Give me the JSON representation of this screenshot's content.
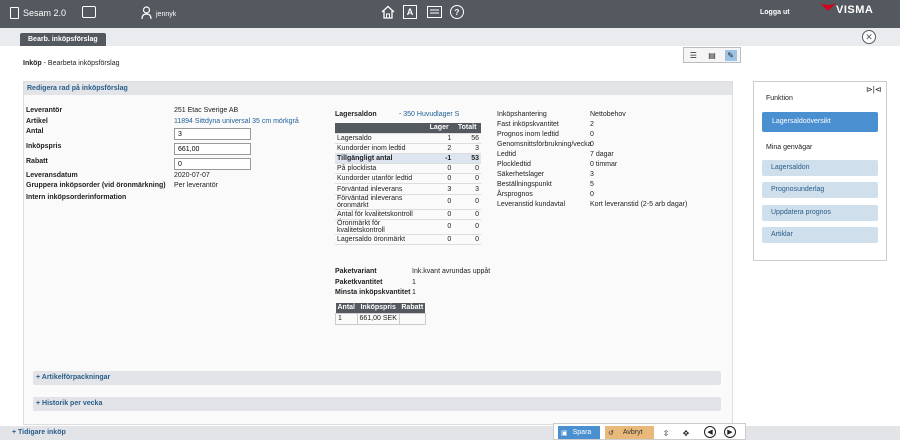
{
  "topbar": {
    "app_name": "Sesam 2.0",
    "username": "jennyk",
    "nav_a_label": "A",
    "nav_help_label": "?",
    "logout": "Logga ut",
    "brand": "VISMA"
  },
  "tabs": {
    "active": "Bearb. inköpsförslag",
    "close_glyph": "✕"
  },
  "breadcrumb": {
    "root": "Inköp",
    "separator": "-",
    "current": "Bearbeta inköpsförslag"
  },
  "panel": {
    "title": "Redigera rad på inköpsförslag",
    "fields": {
      "leverantor_label": "Leverantör",
      "leverantor_value": "251 Etac Sverige AB",
      "artikel_label": "Artikel",
      "artikel_value": "11894 Sittdyna universal 35 cm mörkgrå",
      "antal_label": "Antal",
      "antal_value": "3",
      "inkopspris_label": "Inköpspris",
      "inkopspris_value": "661,00",
      "rabatt_label": "Rabatt",
      "rabatt_value": "0",
      "leveransdatum_label": "Leveransdatum",
      "leveransdatum_value": "2020-07-07",
      "gruppera_label": "Gruppera inköpsorder (vid öronmärkning)",
      "gruppera_value": "Per leverantör",
      "intern_label": "Intern inköpsorderinformation"
    },
    "lagersaldon": {
      "label": "Lagersaldon",
      "link": "- 350 Huvudlager S",
      "headers": [
        "",
        "Lager",
        "Totalt"
      ],
      "rows": [
        [
          "Lagersaldo",
          "1",
          "56"
        ],
        [
          "Kundorder inom ledtid",
          "2",
          "3"
        ],
        [
          "Tillgängligt antal",
          "-1",
          "53"
        ],
        [
          "På plocklista",
          "0",
          "0"
        ],
        [
          "Kundorder utanför ledtid",
          "0",
          "0"
        ],
        [
          "Förväntad inleverans",
          "3",
          "3"
        ],
        [
          "Förväntad inleverans öronmärkt",
          "0",
          "0"
        ],
        [
          "Antal för kvalitetskontroll",
          "0",
          "0"
        ],
        [
          "Öronmärkt för kvalitetskontroll",
          "0",
          "0"
        ],
        [
          "Lagersaldo öronmärkt",
          "0",
          "0"
        ]
      ]
    },
    "inkop_info": [
      [
        "Inköpshantering",
        "Nettobehov"
      ],
      [
        "Fast inköpskvantitet",
        "2"
      ],
      [
        "Prognos inom ledtid",
        "0"
      ],
      [
        "Genomsnittsförbrukning/vecka",
        "0"
      ],
      [
        "Ledtid",
        "7 dagar"
      ],
      [
        "Plockledtid",
        "0 timmar"
      ],
      [
        "Säkerhetslager",
        "3"
      ],
      [
        "Beställningspunkt",
        "5"
      ],
      [
        "Årsprognos",
        "0"
      ],
      [
        "Leveranstid kundavtal",
        "Kort leveranstid (2-5 arb dagar)"
      ]
    ],
    "paket": {
      "variant_label": "Paketvariant",
      "variant_value": "Ink.kvant avrundas uppåt",
      "kvantitet_label": "Paketkvantitet",
      "kvantitet_value": "1",
      "minsta_label": "Minsta inköpskvantitet",
      "minsta_value": "1",
      "headers": [
        "Antal",
        "Inköpspris",
        "Rabatt"
      ],
      "rows": [
        [
          "1",
          "661,00 SEK",
          ""
        ]
      ]
    },
    "collapsibles": [
      "+ Artikelförpackningar",
      "+ Historik per vecka"
    ]
  },
  "sidepanel": {
    "funktion_label": "Funktion",
    "primary": "Lagersaldoöversikt",
    "shortcuts_label": "Mina genvägar",
    "shortcuts": [
      "Lagersaldon",
      "Prognosunderlag",
      "Uppdatera prognos",
      "Artiklar"
    ]
  },
  "bottom": {
    "tidigare": "+ Tidigare inköp",
    "save": "Spara",
    "cancel": "Avbryt"
  }
}
